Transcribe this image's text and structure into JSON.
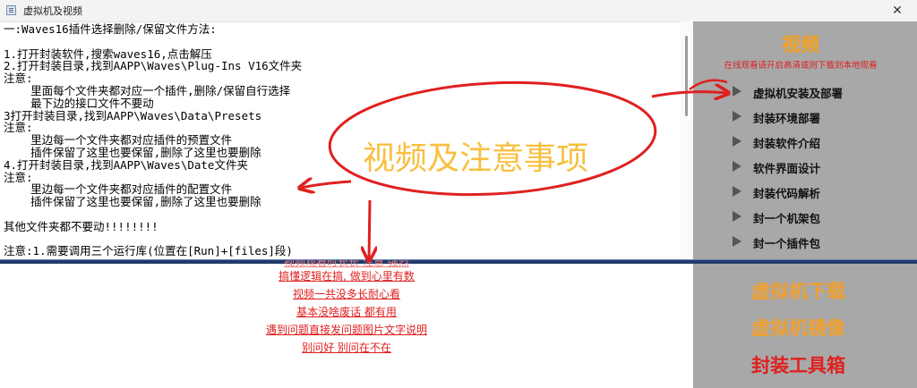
{
  "window": {
    "title": "虚拟机及视频",
    "close_glyph": "✕"
  },
  "instructions": {
    "lines": [
      "一:Waves16插件选择删除/保留文件方法:",
      "",
      "1.打开封装软件,搜索waves16,点击解压",
      "2.打开封装目录,找到AAPP\\Waves\\Plug-Ins V16文件夹",
      "注意:",
      "    里面每个文件夹都对应一个插件,删除/保留自行选择",
      "    最下边的接口文件不要动",
      "3打开封装目录,找到AAPP\\Waves\\Data\\Presets",
      "注意:",
      "    里边每一个文件夹都对应插件的预置文件",
      "    插件保留了这里也要保留,删除了这里也要删除",
      "4.打开封装目录,找到AAPP\\Waves\\Date文件夹",
      "注意:",
      "    里边每一个文件夹都对应插件的配置文件",
      "    插件保留了这里也要保留,删除了这里也要删除",
      "",
      "其他文件夹都不要动!!!!!!!!",
      "",
      "注意:1.需要调用三个运行库(位置在[Run]+[files]段)"
    ]
  },
  "sidebar": {
    "video_title": "视频",
    "video_subtitle": "在线观看请开启高清或则下载到本地观看",
    "menu": [
      {
        "label": "虚拟机安装及部署"
      },
      {
        "label": "封装环境部署"
      },
      {
        "label": "封装软件介绍"
      },
      {
        "label": "软件界面设计"
      },
      {
        "label": "封装代码解析"
      },
      {
        "label": "封一个机架包"
      },
      {
        "label": "封一个插件包"
      }
    ]
  },
  "notes": {
    "links": [
      "视频观看时长长 注意 强烈",
      "搞懂逻辑在搞, 做到心里有数",
      "视频一共没多长耐心看",
      "基本没啥废话 都有用",
      "遇到问题直接发问题图片文字说明",
      "别问好 别问在不在"
    ]
  },
  "actions": {
    "vm_download": "虚拟机下载",
    "vm_image": "虚拟机镜像",
    "toolbox": "封装工具箱"
  },
  "annotation": {
    "text": "视频及注意事项"
  },
  "colors": {
    "accent_orange": "#f5a020",
    "link_red": "#e02020",
    "annotation_red": "#e02020",
    "panel_gray": "#a8a8a8"
  }
}
